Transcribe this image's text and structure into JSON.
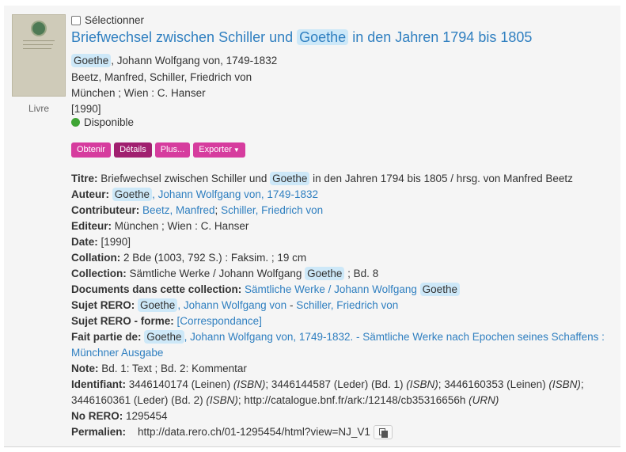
{
  "record": {
    "type_label": "Livre",
    "select_label": "Sélectionner",
    "title": {
      "before": "Briefwechsel zwischen Schiller und ",
      "hl": "Goethe",
      "after": " in den Jahren 1794 bis 1805"
    },
    "author_line": {
      "hl": "Goethe",
      "rest": ", Johann Wolfgang von, 1749-1832"
    },
    "contributors_line": "Beetz, Manfred, Schiller, Friedrich von",
    "publisher_line": "München ; Wien : C. Hanser",
    "date_line": "[1990]",
    "availability": "Disponible",
    "availability_color": "#3fa535"
  },
  "buttons": {
    "obtain": "Obtenir",
    "details": "Détails",
    "more": "Plus...",
    "export": "Exporter"
  },
  "details": {
    "titre": {
      "label": "Titre:",
      "before": " Briefwechsel zwischen Schiller und ",
      "hl": "Goethe",
      "after": " in den Jahren 1794 bis 1805 / hrsg. von Manfred Beetz"
    },
    "auteur": {
      "label": "Auteur:",
      "hl": "Goethe",
      "link": ", Johann Wolfgang von, 1749-1832"
    },
    "contributeur": {
      "label": "Contributeur:",
      "link1": "Beetz, Manfred",
      "sep": "; ",
      "link2": "Schiller, Friedrich von"
    },
    "editeur": {
      "label": "Editeur:",
      "value": " München ; Wien : C. Hanser"
    },
    "date": {
      "label": "Date:",
      "value": " [1990]"
    },
    "collation": {
      "label": "Collation:",
      "value": " 2 Bde (1003, 792 S.) : Faksim. ; 19 cm"
    },
    "collection": {
      "label": "Collection:",
      "before": " Sämtliche Werke / Johann Wolfgang ",
      "hl": "Goethe",
      "after": " ; Bd. 8"
    },
    "documents": {
      "label": "Documents dans cette collection:",
      "link": " Sämtliche Werke / Johann Wolfgang ",
      "hl": "Goethe"
    },
    "sujet": {
      "label": "Sujet RERO:",
      "hl": "Goethe",
      "link1": ", Johann Wolfgang von",
      "sep": " - ",
      "link2": "Schiller, Friedrich von"
    },
    "sujet_forme": {
      "label": "Sujet RERO - forme:",
      "link": "[Correspondance]"
    },
    "fait_partie": {
      "label": "Fait partie de:",
      "hl": "Goethe",
      "link": ", Johann Wolfgang von, 1749-1832. - Sämtliche Werke nach Epochen seines Schaffens : Münchner Ausgabe"
    },
    "note": {
      "label": "Note:",
      "value": " Bd. 1: Text ; Bd. 2: Kommentar"
    },
    "identifiant": {
      "label": "Identifiant:",
      "p1": " 3446140174 (Leinen) ",
      "i1": "(ISBN)",
      "p2": "; 3446144587 (Leder) (Bd. 1) ",
      "i2": "(ISBN)",
      "p3": "; 3446160353 (Leinen) ",
      "i3": "(ISBN)",
      "p4": "; 3446160361 (Leder) (Bd. 2) ",
      "i4": "(ISBN)",
      "p5": "; http://catalogue.bnf.fr/ark:/12148/cb35316656h ",
      "i5": "(URN)"
    },
    "no_rero": {
      "label": "No RERO:",
      "value": " 1295454"
    },
    "permalien": {
      "label": "Permalien:",
      "value": "http://data.rero.ch/01-1295454/html?view=NJ_V1"
    }
  },
  "icons": {
    "copy": "copy-icon",
    "availability": "status-dot-icon",
    "cover": "book-cover-thumbnail"
  }
}
